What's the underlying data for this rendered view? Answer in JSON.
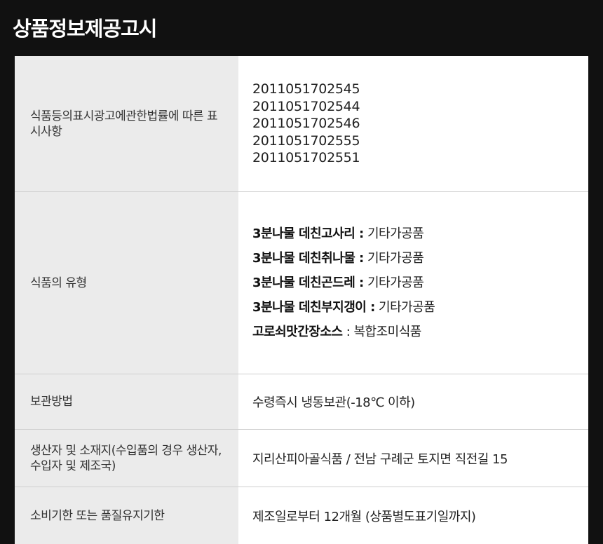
{
  "page_title": "상품정보제공고시",
  "rows": {
    "labeling": {
      "label": "식품등의표시광고에관한법률에 따른 표시사항",
      "codes": [
        "2011051702545",
        "2011051702544",
        "2011051702546",
        "2011051702555",
        "2011051702551"
      ]
    },
    "food_type": {
      "label": "식품의 유형",
      "items": [
        {
          "name": "3분나물 데친고사리 :",
          "type": " 기타가공품"
        },
        {
          "name": "3분나물 데친취나물 :",
          "type": " 기타가공품"
        },
        {
          "name": "3분나물 데친곤드레 :",
          "type": " 기타가공품"
        },
        {
          "name": "3분나물 데친부지갱이 :",
          "type": " 기타가공품"
        },
        {
          "name": "고로쇠맛간장소스",
          "type": " : 복합조미식품"
        }
      ]
    },
    "storage": {
      "label": "보관방법",
      "value": "수령즉시 냉동보관(-18℃ 이하)"
    },
    "producer": {
      "label": "생산자 및 소재지(수입품의 경우 생산자, 수입자 및 제조국)",
      "value": "지리산피아골식품 / 전남 구례군 토지면 직전길 15"
    },
    "expiry": {
      "label": "소비기한 또는 품질유지기한",
      "value": "제조일로부터 12개월 (상품별도표기일까지)"
    }
  }
}
